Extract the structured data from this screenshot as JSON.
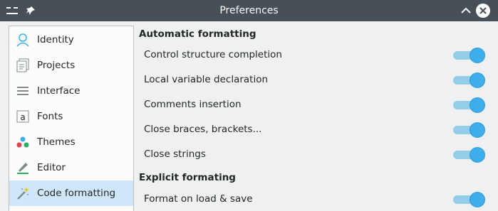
{
  "window": {
    "title": "Preferences"
  },
  "sidebar": {
    "items": [
      {
        "label": "Identity",
        "icon": "user-icon"
      },
      {
        "label": "Projects",
        "icon": "projects-icon"
      },
      {
        "label": "Interface",
        "icon": "interface-icon"
      },
      {
        "label": "Fonts",
        "icon": "fonts-icon"
      },
      {
        "label": "Themes",
        "icon": "themes-icon"
      },
      {
        "label": "Editor",
        "icon": "editor-icon"
      },
      {
        "label": "Code formatting",
        "icon": "magic-wand-icon",
        "active": true
      }
    ]
  },
  "sections": {
    "automatic": {
      "title": "Automatic formatting",
      "rows": [
        {
          "label": "Control structure completion",
          "on": true
        },
        {
          "label": "Local variable declaration",
          "on": true
        },
        {
          "label": "Comments insertion",
          "on": true
        },
        {
          "label": "Close braces, brackets...",
          "on": true
        },
        {
          "label": "Close strings",
          "on": true
        }
      ]
    },
    "explicit": {
      "title": "Explicit formating",
      "rows": [
        {
          "label": "Format on load & save",
          "on": true
        }
      ]
    }
  },
  "colors": {
    "accent": "#3daee9",
    "selection": "#cfe7f8",
    "titlebar": "#475057"
  }
}
